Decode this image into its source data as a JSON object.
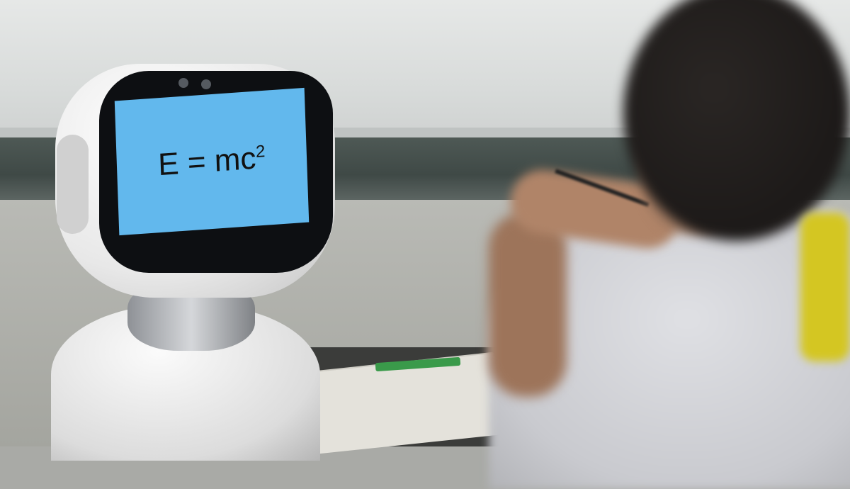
{
  "scene": {
    "description_colors": {
      "screen": "#62b8ed",
      "robot": "#e8e8e8",
      "ledge": "#4e5955",
      "strap": "#d4c622"
    },
    "robot_screen": {
      "formula": "E = mc",
      "exponent": "2"
    }
  }
}
